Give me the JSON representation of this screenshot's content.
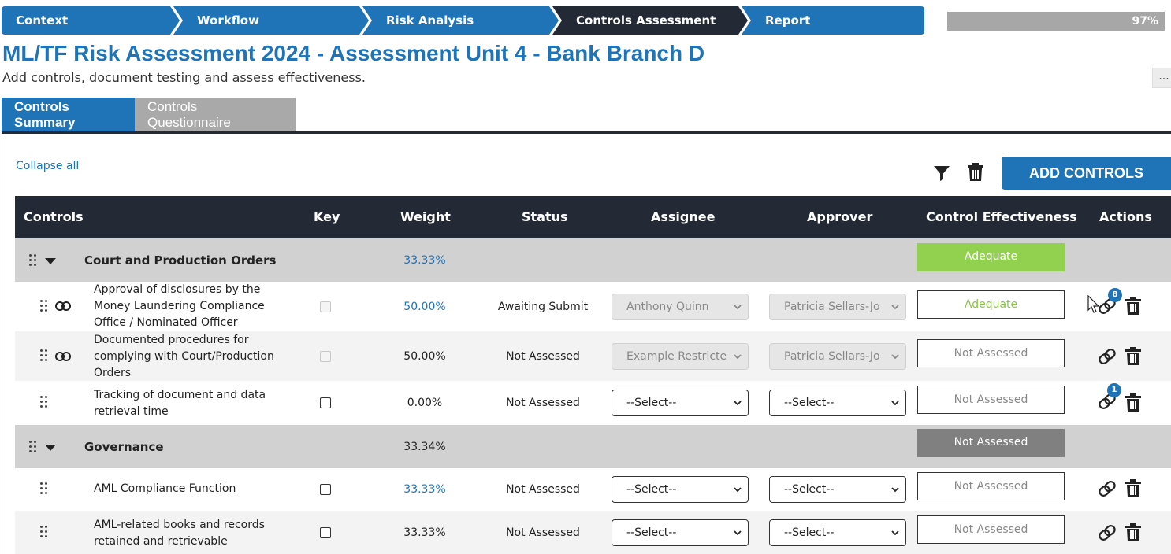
{
  "workflow": {
    "steps": [
      {
        "label": "Context",
        "active": false
      },
      {
        "label": "Workflow",
        "active": false
      },
      {
        "label": "Risk Analysis",
        "active": false
      },
      {
        "label": "Controls Assessment",
        "active": true
      },
      {
        "label": "Report",
        "active": false
      }
    ],
    "progress_text": "97%",
    "progress_value": 97
  },
  "header": {
    "title": "ML/TF Risk Assessment 2024 - Assessment Unit 4 - Bank Branch D",
    "subtitle": "Add controls, document testing and assess effectiveness.",
    "more_label": "..."
  },
  "tabs": [
    {
      "label": "Controls Summary",
      "active": true
    },
    {
      "label": "Controls Questionnaire",
      "active": false
    }
  ],
  "toolbar": {
    "collapse_label": "Collapse all",
    "add_label": "ADD CONTROLS"
  },
  "table": {
    "headers": {
      "controls": "Controls",
      "key": "Key",
      "weight": "Weight",
      "status": "Status",
      "assignee": "Assignee",
      "approver": "Approver",
      "effectiveness": "Control Effectiveness",
      "actions": "Actions"
    },
    "groups": [
      {
        "name": "Court and Production Orders",
        "weight": "33.33%",
        "effectiveness": "Adequate",
        "items": [
          {
            "name": "Approval of disclosures by the Money Laundering Compliance Office / Nominated Officer",
            "weight": "50.00%",
            "status": "Awaiting Submit",
            "assignee": "Anthony Quinn",
            "approver": "Patricia Sellars-Jo",
            "effectiveness": "Adequate",
            "link_badge": "8"
          },
          {
            "name": "Documented procedures for complying with Court/Production Orders",
            "weight": "50.00%",
            "status": "Not Assessed",
            "assignee": "Example Restricte",
            "approver": "Patricia Sellars-Jo",
            "effectiveness": "Not Assessed"
          },
          {
            "name": "Tracking of document and data retrieval time",
            "weight": "0.00%",
            "status": "Not Assessed",
            "assignee": "--Select--",
            "approver": "--Select--",
            "effectiveness": "Not Assessed",
            "link_badge": "1"
          }
        ]
      },
      {
        "name": "Governance",
        "weight": "33.34%",
        "effectiveness": "Not Assessed",
        "items": [
          {
            "name": "AML Compliance Function",
            "weight": "33.33%",
            "status": "Not Assessed",
            "assignee": "--Select--",
            "approver": "--Select--",
            "effectiveness": "Not Assessed"
          },
          {
            "name": "AML-related books and records retained and retrievable",
            "weight": "33.33%",
            "status": "Not Assessed",
            "assignee": "--Select--",
            "approver": "--Select--",
            "effectiveness": "Not Assessed"
          }
        ]
      }
    ]
  },
  "colors": {
    "primary": "#1f73b7",
    "dark": "#242a35",
    "adequate_green": "#92d050",
    "group_bg": "#d1d1d1"
  }
}
